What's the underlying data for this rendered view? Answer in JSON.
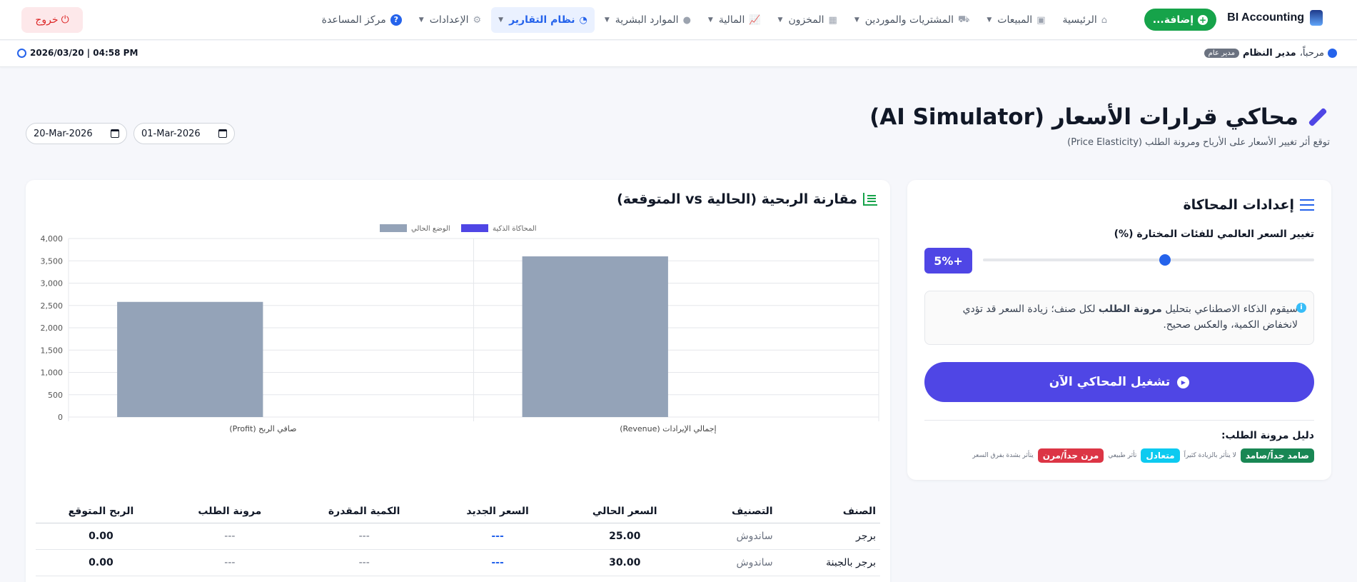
{
  "nav": {
    "brand": "BI Accounting",
    "add_button": "إضافة...",
    "items": [
      {
        "label": "الرئيسية",
        "icon": "home-icon",
        "dropdown": false
      },
      {
        "label": "المبيعات",
        "icon": "bag-icon",
        "dropdown": true
      },
      {
        "label": "المشتريات والموردين",
        "icon": "truck-icon",
        "dropdown": true
      },
      {
        "label": "المخزون",
        "icon": "boxes-icon",
        "dropdown": true
      },
      {
        "label": "المالية",
        "icon": "chart-line-icon",
        "dropdown": true
      },
      {
        "label": "الموارد البشرية",
        "icon": "user-icon",
        "dropdown": true
      },
      {
        "label": "نظام التقارير",
        "icon": "pie-chart-icon",
        "dropdown": true,
        "active": true
      },
      {
        "label": "الإعدادات",
        "icon": "gear-icon",
        "dropdown": true
      },
      {
        "label": "مركز المساعدة",
        "icon": "help-icon",
        "dropdown": false
      }
    ],
    "logout": "خروج"
  },
  "subbar": {
    "welcome": "مرحباً،",
    "user_name": "مدير النظام",
    "role": "مدير عام",
    "datetime": "2026/03/20 | 04:58 PM"
  },
  "page": {
    "title": "محاكي قرارات الأسعار (AI Simulator)",
    "subtitle": "توقع أثر تغيير الأسعار على الأرباح ومرونة الطلب (Price Elasticity)",
    "date_from": "01-Mar-2026",
    "date_to": "20-Mar-2026"
  },
  "settings": {
    "title": "إعدادات المحاكاة",
    "slider_label": "تغيير السعر العالمي للفئات المختارة (%)",
    "slider_value_label": "+5%",
    "slider_fraction": 0.55,
    "info_prefix": "سيقوم الذكاء الاصطناعي بتحليل",
    "info_bold": "مرونة الطلب",
    "info_suffix": "لكل صنف؛ زيادة السعر قد تؤدي لانخفاض الكمية، والعكس صحيح.",
    "run_button": "تشغيل المحاكي الآن",
    "guide_title": "دليل مرونة الطلب:",
    "guide": [
      {
        "badge": "صامد جداً/صامد",
        "note": "لا يتأثر بالزيادة كثيراً",
        "color": "#198754"
      },
      {
        "badge": "متعادل",
        "note": "تأثر طبيعي",
        "color": "#0dcaf0"
      },
      {
        "badge": "مرن جداً/مرن",
        "note": "يتأثر بشدة بفرق السعر",
        "color": "#dc3545"
      }
    ]
  },
  "chart": {
    "title": "مقارنة الربحية (الحالية vs المتوقعة)"
  },
  "chart_data": {
    "type": "bar",
    "categories": [
      "إجمالي الإيرادات (Revenue)",
      "صافي الربح (Profit)"
    ],
    "series": [
      {
        "name": "الوضع الحالي",
        "values": [
          3600,
          2580
        ],
        "color": "#94a3b8"
      },
      {
        "name": "المحاكاة الذكية",
        "values": [
          0,
          0
        ],
        "color": "#4f46e5"
      }
    ],
    "ylim": [
      0,
      4000
    ],
    "yticks": [
      "0",
      "500",
      "1,000",
      "1,500",
      "2,000",
      "2,500",
      "3,000",
      "3,500",
      "4,000"
    ],
    "legend_position": "top",
    "grid": true
  },
  "table": {
    "headers": [
      "الصنف",
      "التصنيف",
      "السعر الحالي",
      "السعر الجديد",
      "الكمية المقدرة",
      "مرونة الطلب",
      "الربح المتوقع"
    ],
    "rows": [
      [
        "برجر",
        "ساندوش",
        "25.00",
        "---",
        "---",
        "---",
        "0.00"
      ],
      [
        "برجر بالجبنة",
        "ساندوش",
        "30.00",
        "---",
        "---",
        "---",
        "0.00"
      ]
    ]
  }
}
